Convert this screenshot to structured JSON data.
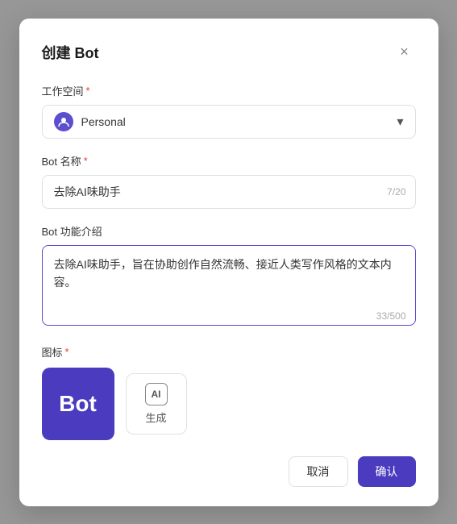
{
  "dialog": {
    "title": "创建 Bot",
    "close_label": "×"
  },
  "workspace_field": {
    "label": "工作空间",
    "required": true,
    "value": "Personal"
  },
  "bot_name_field": {
    "label": "Bot 名称",
    "required": true,
    "value": "去除AI味助手",
    "char_count": "7/20"
  },
  "bot_desc_field": {
    "label": "Bot 功能介绍",
    "required": false,
    "value": "去除AI味助手，旨在协助创作自然流畅、接近人类写作风格的文本内容。",
    "char_count": "33/500"
  },
  "icon_field": {
    "label": "图标",
    "required": true,
    "preview_text": "Bot",
    "generate_label": "生成",
    "ai_icon_label": "AI"
  },
  "footer": {
    "cancel_label": "取消",
    "confirm_label": "确认"
  }
}
